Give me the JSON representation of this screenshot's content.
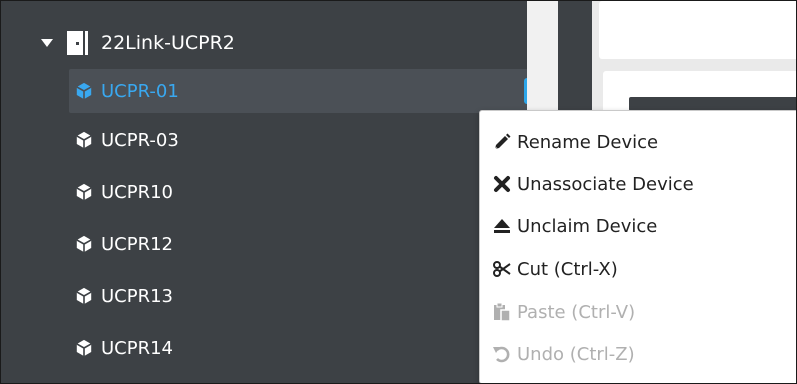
{
  "tree": {
    "root_label": "22Link-UCPR2",
    "devices": [
      {
        "label": "UCPR-01",
        "selected": true
      },
      {
        "label": "UCPR-03",
        "selected": false
      },
      {
        "label": "UCPR10",
        "selected": false
      },
      {
        "label": "UCPR12",
        "selected": false
      },
      {
        "label": "UCPR13",
        "selected": false
      },
      {
        "label": "UCPR14",
        "selected": false
      }
    ]
  },
  "context_menu": {
    "items": [
      {
        "label": "Rename Device",
        "icon": "pencil-icon",
        "enabled": true
      },
      {
        "label": "Unassociate Device",
        "icon": "close-icon",
        "enabled": true
      },
      {
        "label": "Unclaim Device",
        "icon": "eject-icon",
        "enabled": true
      },
      {
        "label": "Cut (Ctrl-X)",
        "icon": "scissors-icon",
        "enabled": true
      },
      {
        "label": "Paste (Ctrl-V)",
        "icon": "paste-icon",
        "enabled": false
      },
      {
        "label": "Undo (Ctrl-Z)",
        "icon": "undo-icon",
        "enabled": false
      }
    ]
  },
  "colors": {
    "sidebar_bg": "#3d4145",
    "selected_text": "#39a8f0",
    "menu_button": "#2ca6ea",
    "disabled_text": "#b0b0b0"
  }
}
